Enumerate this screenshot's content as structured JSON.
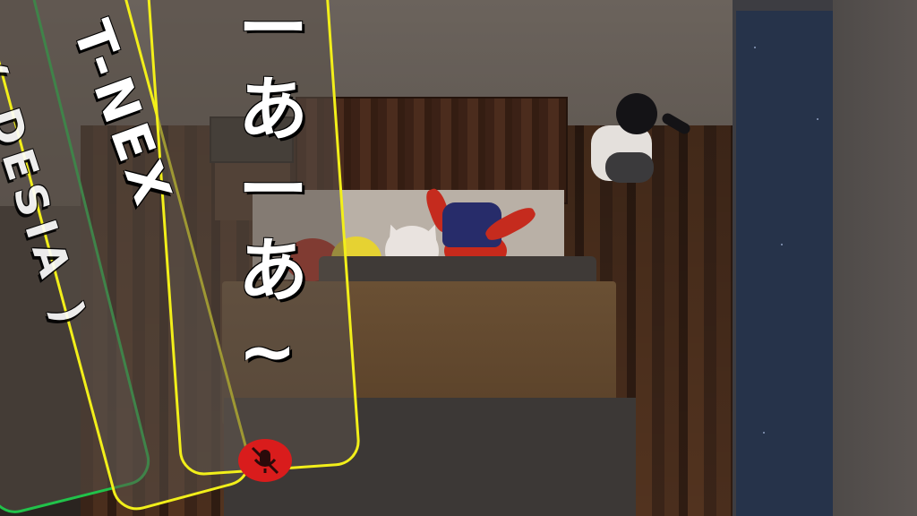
{
  "nameplates": {
    "primary_name": "T-NEX",
    "secondary_tag": "( DESIA )",
    "chat_bubble_text": [
      "ー",
      "あ",
      "ー",
      "あ",
      "~"
    ]
  },
  "status": {
    "mic_state": "muted",
    "mute_icon": "microphone-off-icon",
    "mute_color": "#d91c1c"
  },
  "colors": {
    "friend_outline": "#f2ef1a",
    "trusted_outline": "#21c24a"
  }
}
